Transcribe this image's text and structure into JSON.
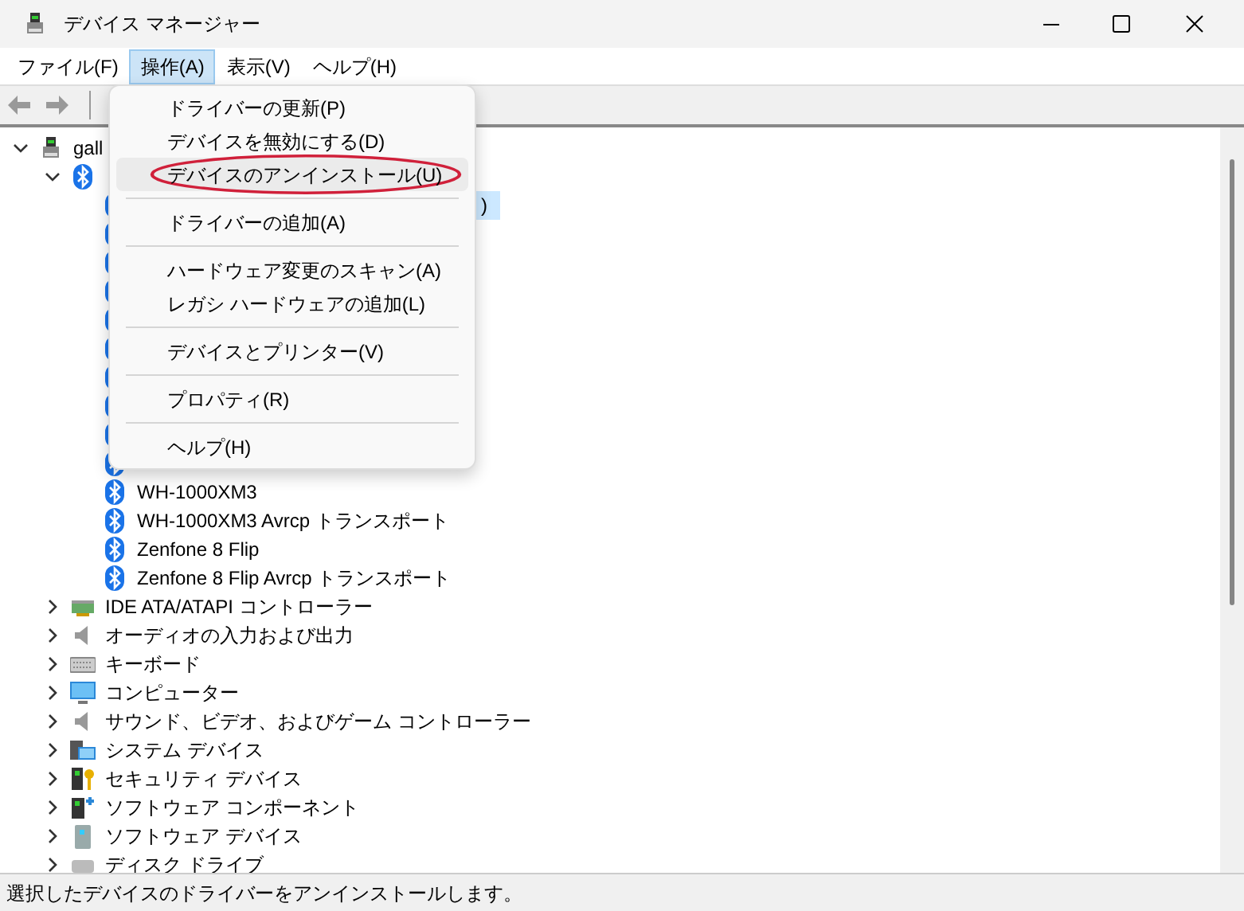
{
  "window": {
    "title": "デバイス マネージャー"
  },
  "menu_bar": [
    {
      "label": "ファイル(F)",
      "selected": false
    },
    {
      "label": "操作(A)",
      "selected": true
    },
    {
      "label": "表示(V)",
      "selected": false
    },
    {
      "label": "ヘルプ(H)",
      "selected": false
    }
  ],
  "tree": [
    {
      "kind": "computer",
      "label": "gall",
      "expanded": true,
      "children": [
        {
          "kind": "bluetooth",
          "expanded": true,
          "children": [
            {
              "kind": "bluetooth",
              "label": ")",
              "selected": true
            },
            {
              "kind": "bluetooth"
            },
            {
              "kind": "bluetooth"
            },
            {
              "kind": "bluetooth"
            },
            {
              "kind": "bluetooth"
            },
            {
              "kind": "bluetooth"
            },
            {
              "kind": "bluetooth"
            },
            {
              "kind": "bluetooth"
            },
            {
              "kind": "bluetooth"
            },
            {
              "kind": "bluetooth"
            },
            {
              "kind": "bluetooth",
              "label": "WH-1000XM3",
              "selected": false
            },
            {
              "kind": "bluetooth",
              "label": "WH-1000XM3 Avrcp トランスポート",
              "selected": false
            },
            {
              "kind": "bluetooth",
              "label": "Zenfone 8 Flip",
              "selected": false
            },
            {
              "kind": "bluetooth",
              "label": "Zenfone 8 Flip Avrcp トランスポート",
              "selected": false
            }
          ]
        },
        {
          "kind": "ide",
          "label": "IDE ATA/ATAPI コントローラー",
          "expanded": false
        },
        {
          "kind": "audio",
          "label": "オーディオの入力および出力",
          "expanded": false
        },
        {
          "kind": "keyboard",
          "label": "キーボード",
          "expanded": false
        },
        {
          "kind": "monitor",
          "label": "コンピューター",
          "expanded": false
        },
        {
          "kind": "audio",
          "label": "サウンド、ビデオ、およびゲーム コントローラー",
          "expanded": false
        },
        {
          "kind": "system",
          "label": "システム デバイス",
          "expanded": false
        },
        {
          "kind": "security",
          "label": "セキュリティ デバイス",
          "expanded": false
        },
        {
          "kind": "component",
          "label": "ソフトウェア コンポーネント",
          "expanded": false
        },
        {
          "kind": "softdev",
          "label": "ソフトウェア デバイス",
          "expanded": false
        },
        {
          "kind": "disk",
          "label": "ディスク ドライブ",
          "expanded": false
        }
      ]
    }
  ],
  "action_menu": [
    {
      "kind": "item",
      "label": "ドライバーの更新(P)",
      "selected": false
    },
    {
      "kind": "item",
      "label": "デバイスを無効にする(D)",
      "selected": false
    },
    {
      "kind": "item",
      "label": "デバイスのアンインストール(U)",
      "selected": true,
      "annotated": true
    },
    {
      "kind": "separator"
    },
    {
      "kind": "item",
      "label": "ドライバーの追加(A)",
      "selected": false
    },
    {
      "kind": "separator"
    },
    {
      "kind": "item",
      "label": "ハードウェア変更のスキャン(A)",
      "selected": false
    },
    {
      "kind": "item",
      "label": "レガシ ハードウェアの追加(L)",
      "selected": false
    },
    {
      "kind": "separator"
    },
    {
      "kind": "item",
      "label": "デバイスとプリンター(V)",
      "selected": false
    },
    {
      "kind": "separator"
    },
    {
      "kind": "item",
      "label": "プロパティ(R)",
      "selected": false
    },
    {
      "kind": "separator"
    },
    {
      "kind": "item",
      "label": "ヘルプ(H)",
      "selected": false
    }
  ],
  "status_bar": "選択したデバイスのドライバーをアンインストールします。"
}
